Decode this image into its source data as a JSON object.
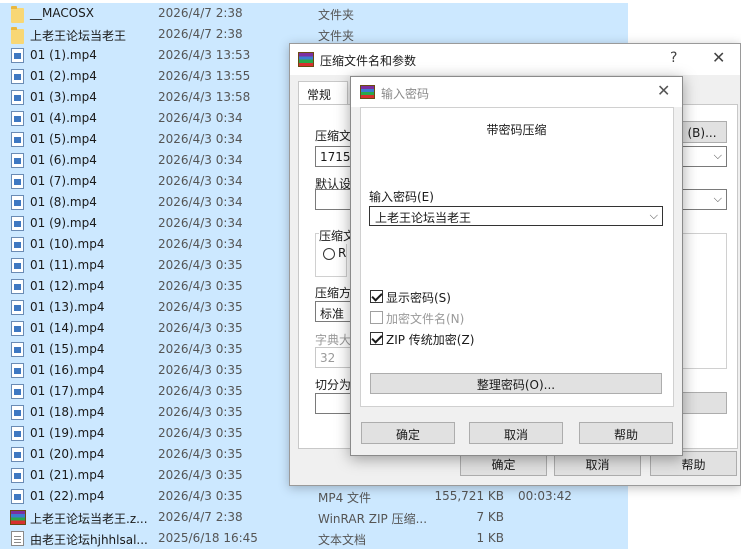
{
  "files": [
    {
      "name": "__MACOSX",
      "date": "2026/4/7 2:38",
      "type": "文件夹",
      "size": "",
      "duration": "",
      "icon": "folder-icon",
      "selected": true
    },
    {
      "name": "上老王论坛当老王",
      "date": "2026/4/7 2:38",
      "type": "文件夹",
      "size": "",
      "duration": "",
      "icon": "folder-icon",
      "selected": true
    },
    {
      "name": "01 (1).mp4",
      "date": "2026/4/3 13:53",
      "type": "",
      "size": "",
      "duration": "",
      "icon": "video-icon",
      "selected": true
    },
    {
      "name": "01 (2).mp4",
      "date": "2026/4/3 13:55",
      "type": "",
      "size": "",
      "duration": "",
      "icon": "video-icon",
      "selected": true
    },
    {
      "name": "01 (3).mp4",
      "date": "2026/4/3 13:58",
      "type": "",
      "size": "",
      "duration": "",
      "icon": "video-icon",
      "selected": true
    },
    {
      "name": "01 (4).mp4",
      "date": "2026/4/3 0:34",
      "type": "",
      "size": "",
      "duration": "",
      "icon": "video-icon",
      "selected": true
    },
    {
      "name": "01 (5).mp4",
      "date": "2026/4/3 0:34",
      "type": "",
      "size": "",
      "duration": "",
      "icon": "video-icon",
      "selected": true
    },
    {
      "name": "01 (6).mp4",
      "date": "2026/4/3 0:34",
      "type": "",
      "size": "",
      "duration": "",
      "icon": "video-icon",
      "selected": true
    },
    {
      "name": "01 (7).mp4",
      "date": "2026/4/3 0:34",
      "type": "",
      "size": "",
      "duration": "",
      "icon": "video-icon",
      "selected": true
    },
    {
      "name": "01 (8).mp4",
      "date": "2026/4/3 0:34",
      "type": "",
      "size": "",
      "duration": "",
      "icon": "video-icon",
      "selected": true
    },
    {
      "name": "01 (9).mp4",
      "date": "2026/4/3 0:34",
      "type": "",
      "size": "",
      "duration": "",
      "icon": "video-icon",
      "selected": true
    },
    {
      "name": "01 (10).mp4",
      "date": "2026/4/3 0:34",
      "type": "",
      "size": "",
      "duration": "",
      "icon": "video-icon",
      "selected": true
    },
    {
      "name": "01 (11).mp4",
      "date": "2026/4/3 0:35",
      "type": "",
      "size": "",
      "duration": "",
      "icon": "video-icon",
      "selected": true
    },
    {
      "name": "01 (12).mp4",
      "date": "2026/4/3 0:35",
      "type": "",
      "size": "",
      "duration": "",
      "icon": "video-icon",
      "selected": true
    },
    {
      "name": "01 (13).mp4",
      "date": "2026/4/3 0:35",
      "type": "",
      "size": "",
      "duration": "",
      "icon": "video-icon",
      "selected": true
    },
    {
      "name": "01 (14).mp4",
      "date": "2026/4/3 0:35",
      "type": "",
      "size": "",
      "duration": "",
      "icon": "video-icon",
      "selected": true
    },
    {
      "name": "01 (15).mp4",
      "date": "2026/4/3 0:35",
      "type": "",
      "size": "",
      "duration": "",
      "icon": "video-icon",
      "selected": true
    },
    {
      "name": "01 (16).mp4",
      "date": "2026/4/3 0:35",
      "type": "",
      "size": "",
      "duration": "",
      "icon": "video-icon",
      "selected": true
    },
    {
      "name": "01 (17).mp4",
      "date": "2026/4/3 0:35",
      "type": "",
      "size": "",
      "duration": "",
      "icon": "video-icon",
      "selected": true
    },
    {
      "name": "01 (18).mp4",
      "date": "2026/4/3 0:35",
      "type": "",
      "size": "",
      "duration": "",
      "icon": "video-icon",
      "selected": true
    },
    {
      "name": "01 (19).mp4",
      "date": "2026/4/3 0:35",
      "type": "",
      "size": "",
      "duration": "",
      "icon": "video-icon",
      "selected": true
    },
    {
      "name": "01 (20).mp4",
      "date": "2026/4/3 0:35",
      "type": "",
      "size": "",
      "duration": "",
      "icon": "video-icon",
      "selected": true
    },
    {
      "name": "01 (21).mp4",
      "date": "2026/4/3 0:35",
      "type": "",
      "size": "",
      "duration": "",
      "icon": "video-icon",
      "selected": true
    },
    {
      "name": "01 (22).mp4",
      "date": "2026/4/3 0:35",
      "type": "MP4 文件",
      "size": "155,721 KB",
      "duration": "00:03:42",
      "icon": "video-icon",
      "selected": true
    },
    {
      "name": "上老王论坛当老王.z...",
      "date": "2026/4/7 2:38",
      "type": "WinRAR ZIP 压缩...",
      "size": "7 KB",
      "duration": "",
      "icon": "rar-archive-icon",
      "selected": true
    },
    {
      "name": "由老王论坛hjhhlsal...",
      "date": "2025/6/18 16:45",
      "type": "文本文档",
      "size": "1 KB",
      "duration": "",
      "icon": "text-file-icon",
      "selected": true
    }
  ],
  "archive_dialog": {
    "title": "压缩文件名和参数",
    "help": "?",
    "close": "✕",
    "tab_general": "常规",
    "archive_name_label": "压缩文",
    "archive_name_value": "1715.z",
    "browse_button": "(B)...",
    "default_profile_label": "默认设",
    "format_group_label": "压缩文",
    "format_radio_label": "R",
    "method_label": "压缩方",
    "method_value": "标准",
    "dictionary_label": "字典大",
    "dictionary_value": "32",
    "split_label": "切分为",
    "ok": "确定",
    "cancel": "取消",
    "help_button": "帮助"
  },
  "password_dialog": {
    "title": "输入密码",
    "close": "✕",
    "heading": "带密码压缩",
    "password_label": "输入密码(E)",
    "password_value": "上老王论坛当老王",
    "show_password": "显示密码(S)",
    "encrypt_filenames": "加密文件名(N)",
    "zip_legacy": "ZIP 传统加密(Z)",
    "organize_button": "整理密码(O)...",
    "ok": "确定",
    "cancel": "取消",
    "help_button": "帮助"
  },
  "icons": {
    "dropdown": "⌵"
  }
}
